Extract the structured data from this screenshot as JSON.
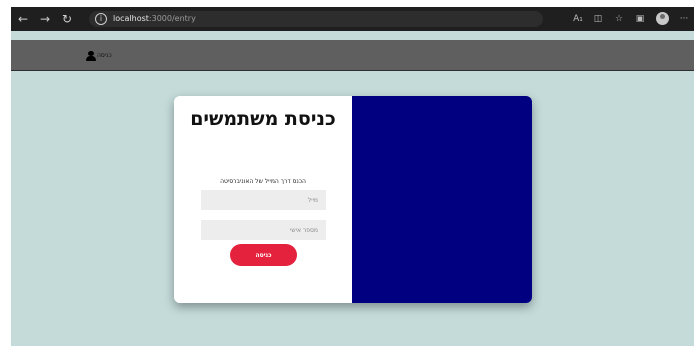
{
  "browser": {
    "url_host": "localhost",
    "url_path": ":3000/entry",
    "icons": [
      "back-icon",
      "forward-icon",
      "refresh-icon",
      "info-icon",
      "read-aloud-icon",
      "tab-icon",
      "favorites-icon",
      "collections-icon",
      "profile-icon",
      "more-icon"
    ]
  },
  "navbar": {
    "login_label": "כניסה"
  },
  "card": {
    "title": "כניסת משתמשים",
    "subtitle": "הכנס דרך המייל של האוניברסיטה",
    "email_placeholder": "מייל",
    "id_placeholder": "מספר אישי",
    "login_button": "כניסה"
  },
  "colors": {
    "page_bg": "#c4dbda",
    "navbar_bg": "#5f5f5f",
    "card_right_bg": "#010080",
    "button_bg": "#e4223d"
  }
}
